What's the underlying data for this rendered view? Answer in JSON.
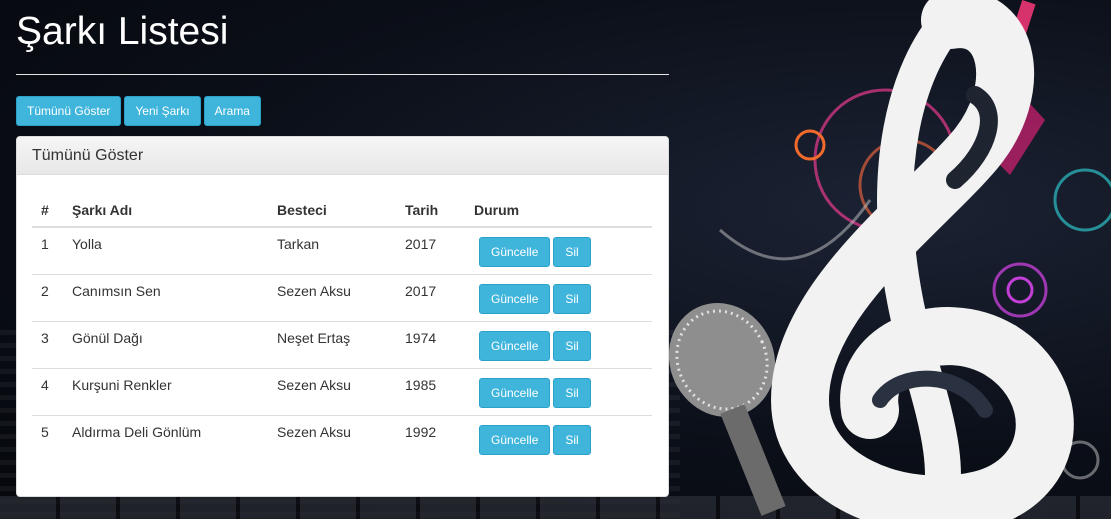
{
  "header": {
    "title": "Şarkı Listesi"
  },
  "nav": {
    "buttons": [
      "Tümünü Göster",
      "Yeni Şarkı",
      "Arama"
    ]
  },
  "panel": {
    "title": "Tümünü Göster",
    "columns": [
      "#",
      "Şarkı Adı",
      "Besteci",
      "Tarih",
      "Durum"
    ],
    "rows": [
      {
        "n": "1",
        "name": "Yolla",
        "composer": "Tarkan",
        "date": "2017"
      },
      {
        "n": "2",
        "name": "Canımsın Sen",
        "composer": "Sezen Aksu",
        "date": "2017"
      },
      {
        "n": "3",
        "name": "Gönül Dağı",
        "composer": "Neşet Ertaş",
        "date": "1974"
      },
      {
        "n": "4",
        "name": "Kurşuni Renkler",
        "composer": "Sezen Aksu",
        "date": "1985"
      },
      {
        "n": "5",
        "name": "Aldırma Deli Gönlüm",
        "composer": "Sezen Aksu",
        "date": "1992"
      }
    ],
    "actions": {
      "update": "Güncelle",
      "delete": "Sil"
    }
  },
  "background": {
    "icons": [
      "treble-clef-icon",
      "microphone-icon",
      "electric-guitar-icon"
    ]
  },
  "colors": {
    "button": "#3fb5dc",
    "page_bg": "#0b0f18"
  }
}
